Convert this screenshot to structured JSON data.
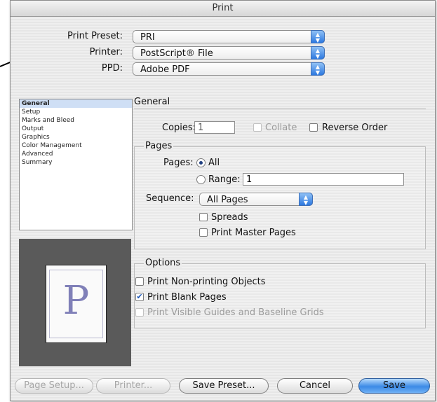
{
  "window": {
    "title": "Print"
  },
  "header": {
    "preset_label": "Print Preset:",
    "preset_value": "PRI",
    "printer_label": "Printer:",
    "printer_value": "PostScript® File",
    "ppd_label": "PPD:",
    "ppd_value": "Adobe PDF"
  },
  "sidebar": {
    "items": [
      {
        "label": "General",
        "selected": true
      },
      {
        "label": "Setup"
      },
      {
        "label": "Marks and Bleed"
      },
      {
        "label": "Output"
      },
      {
        "label": "Graphics"
      },
      {
        "label": "Color Management"
      },
      {
        "label": "Advanced"
      },
      {
        "label": "Summary"
      }
    ]
  },
  "preview": {
    "letter": "P"
  },
  "general": {
    "title": "General",
    "copies_label": "Copies:",
    "copies_value": "1",
    "collate_label": "Collate",
    "reverse_order_label": "Reverse Order"
  },
  "pages": {
    "title": "Pages",
    "pages_label": "Pages:",
    "all_label": "All",
    "range_label": "Range:",
    "range_value": "1",
    "sequence_label": "Sequence:",
    "sequence_value": "All Pages",
    "spreads_label": "Spreads",
    "master_pages_label": "Print Master Pages"
  },
  "options": {
    "title": "Options",
    "nonprinting_label": "Print Non-printing Objects",
    "blank_pages_label": "Print Blank Pages",
    "blank_pages_checked": true,
    "guides_label": "Print Visible Guides and Baseline Grids"
  },
  "buttons": {
    "page_setup": "Page Setup...",
    "printer": "Printer...",
    "save_preset": "Save Preset...",
    "cancel": "Cancel",
    "save": "Save"
  },
  "colors": {
    "accent": "#3b8ae6",
    "list_selection": "#cfdff5"
  }
}
